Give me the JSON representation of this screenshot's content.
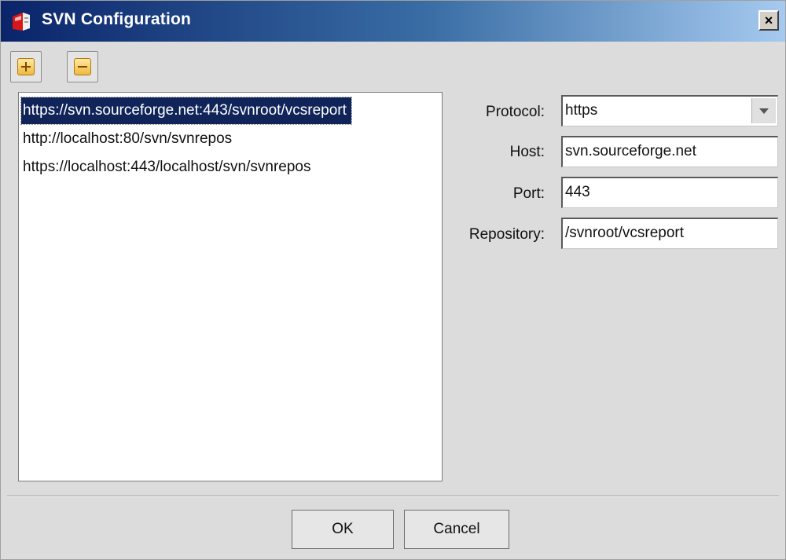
{
  "window": {
    "title": "SVN Configuration",
    "close_label": "×"
  },
  "toolbar": {
    "add_icon": "add-icon",
    "remove_icon": "remove-icon"
  },
  "repositories": [
    {
      "url": "https://svn.sourceforge.net:443/svnroot/vcsreport",
      "selected": true
    },
    {
      "url": "http://localhost:80/svn/svnrepos",
      "selected": false
    },
    {
      "url": "https://localhost:443/localhost/svn/svnrepos",
      "selected": false
    }
  ],
  "form": {
    "protocol": {
      "label": "Protocol:",
      "value": "https"
    },
    "host": {
      "label": "Host:",
      "value": "svn.sourceforge.net"
    },
    "port": {
      "label": "Port:",
      "value": "443"
    },
    "repository": {
      "label": "Repository:",
      "value": "/svnroot/vcsreport"
    }
  },
  "buttons": {
    "ok": "OK",
    "cancel": "Cancel"
  },
  "colors": {
    "title_bar_start": "#0a246a",
    "title_bar_end": "#a6caf0",
    "selection": "#10245a",
    "dialog_bg": "#dcdcdc"
  }
}
